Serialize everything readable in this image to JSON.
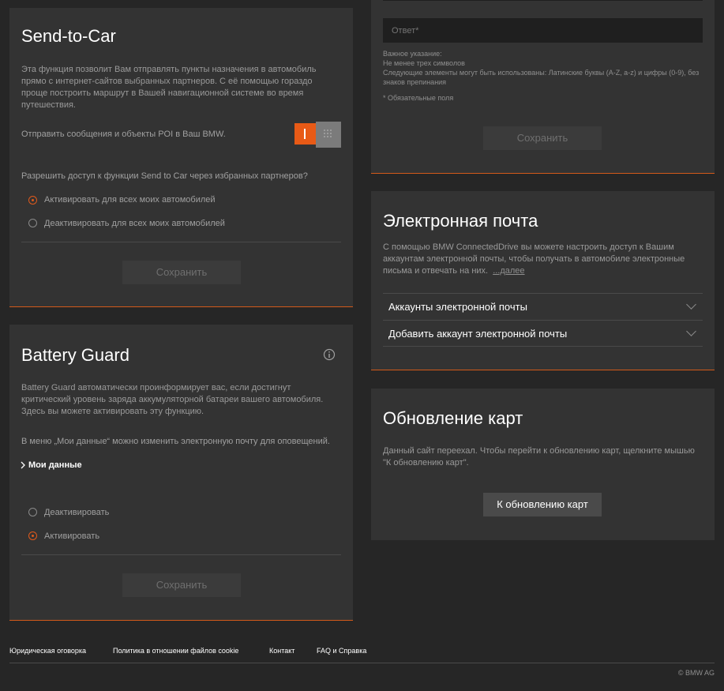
{
  "send_to_car": {
    "title": "Send-to-Car",
    "description": "Эта функция позволит Вам отправлять пункты назначения в автомобиль прямо с интернет-сайтов выбранных партнеров. С её помощью гораздо проще построить маршрут в Вашей навигационной системе во время путешествия.",
    "toggle_label": "Отправить сообщения и объекты POI в Ваш BMW.",
    "toggle_state": "on",
    "question": "Разрешить доступ к функции Send to Car через избранных партнеров?",
    "options": [
      {
        "label": "Активировать для всех моих автомобилей",
        "selected": true
      },
      {
        "label": "Деактивировать для всех моих автомобилей",
        "selected": false
      }
    ],
    "save_label": "Сохранить"
  },
  "battery_guard": {
    "title": "Battery Guard",
    "description": "Battery Guard автоматически проинформирует вас, если достигнут критический уровень заряда аккумуляторной батареи вашего автомобиля. Здесь вы можете активировать эту функцию.",
    "info_text": "В меню „Мои данные“ можно изменить электронную почту для оповещений.",
    "my_data_link": "Мои данные",
    "options": [
      {
        "label": "Деактивировать",
        "selected": false
      },
      {
        "label": "Активировать",
        "selected": true
      }
    ],
    "save_label": "Сохранить"
  },
  "security_form": {
    "answer_placeholder": "Ответ*",
    "hint_lines": [
      "Важное указание:",
      "Не менее трех символов",
      "Следующие элементы могут быть использованы: Латинские буквы (A-Z, a-z) и цифры (0-9), без знаков препинания"
    ],
    "required_note": "* Обязательные поля",
    "save_label": "Сохранить"
  },
  "email": {
    "title": "Электронная почта",
    "description": "С помощью BMW ConnectedDrive вы можете настроить доступ к Вашим аккаунтам электронной почты, чтобы получать в автомобиле электронные письма и отвечать на них.",
    "more_link": "...далее",
    "items": [
      {
        "label": "Аккаунты электронной почты"
      },
      {
        "label": "Добавить аккаунт электронной почты"
      }
    ]
  },
  "map_update": {
    "title": "Обновление карт",
    "description": "Данный сайт переехал. Чтобы перейти к обновлению карт, щелкните мышью \"К обновлению карт\".",
    "button_label": "К обновлению карт"
  },
  "footer": {
    "links": [
      "Юридическая оговорка",
      "Политика в отношении файлов cookie",
      "Контакт",
      "FAQ и Справка"
    ],
    "copyright": "© BMW AG"
  },
  "colors": {
    "accent": "#e05a1c",
    "panel": "#333333",
    "background": "#262626"
  }
}
